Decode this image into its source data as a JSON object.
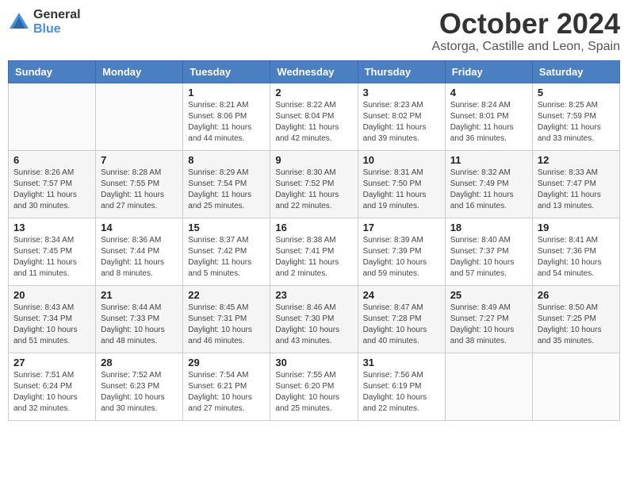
{
  "logo": {
    "general": "General",
    "blue": "Blue"
  },
  "title": "October 2024",
  "location": "Astorga, Castille and Leon, Spain",
  "days_of_week": [
    "Sunday",
    "Monday",
    "Tuesday",
    "Wednesday",
    "Thursday",
    "Friday",
    "Saturday"
  ],
  "weeks": [
    [
      {
        "day": "",
        "info": ""
      },
      {
        "day": "",
        "info": ""
      },
      {
        "day": "1",
        "info": "Sunrise: 8:21 AM\nSunset: 8:06 PM\nDaylight: 11 hours\nand 44 minutes."
      },
      {
        "day": "2",
        "info": "Sunrise: 8:22 AM\nSunset: 8:04 PM\nDaylight: 11 hours\nand 42 minutes."
      },
      {
        "day": "3",
        "info": "Sunrise: 8:23 AM\nSunset: 8:02 PM\nDaylight: 11 hours\nand 39 minutes."
      },
      {
        "day": "4",
        "info": "Sunrise: 8:24 AM\nSunset: 8:01 PM\nDaylight: 11 hours\nand 36 minutes."
      },
      {
        "day": "5",
        "info": "Sunrise: 8:25 AM\nSunset: 7:59 PM\nDaylight: 11 hours\nand 33 minutes."
      }
    ],
    [
      {
        "day": "6",
        "info": "Sunrise: 8:26 AM\nSunset: 7:57 PM\nDaylight: 11 hours\nand 30 minutes."
      },
      {
        "day": "7",
        "info": "Sunrise: 8:28 AM\nSunset: 7:55 PM\nDaylight: 11 hours\nand 27 minutes."
      },
      {
        "day": "8",
        "info": "Sunrise: 8:29 AM\nSunset: 7:54 PM\nDaylight: 11 hours\nand 25 minutes."
      },
      {
        "day": "9",
        "info": "Sunrise: 8:30 AM\nSunset: 7:52 PM\nDaylight: 11 hours\nand 22 minutes."
      },
      {
        "day": "10",
        "info": "Sunrise: 8:31 AM\nSunset: 7:50 PM\nDaylight: 11 hours\nand 19 minutes."
      },
      {
        "day": "11",
        "info": "Sunrise: 8:32 AM\nSunset: 7:49 PM\nDaylight: 11 hours\nand 16 minutes."
      },
      {
        "day": "12",
        "info": "Sunrise: 8:33 AM\nSunset: 7:47 PM\nDaylight: 11 hours\nand 13 minutes."
      }
    ],
    [
      {
        "day": "13",
        "info": "Sunrise: 8:34 AM\nSunset: 7:45 PM\nDaylight: 11 hours\nand 11 minutes."
      },
      {
        "day": "14",
        "info": "Sunrise: 8:36 AM\nSunset: 7:44 PM\nDaylight: 11 hours\nand 8 minutes."
      },
      {
        "day": "15",
        "info": "Sunrise: 8:37 AM\nSunset: 7:42 PM\nDaylight: 11 hours\nand 5 minutes."
      },
      {
        "day": "16",
        "info": "Sunrise: 8:38 AM\nSunset: 7:41 PM\nDaylight: 11 hours\nand 2 minutes."
      },
      {
        "day": "17",
        "info": "Sunrise: 8:39 AM\nSunset: 7:39 PM\nDaylight: 10 hours\nand 59 minutes."
      },
      {
        "day": "18",
        "info": "Sunrise: 8:40 AM\nSunset: 7:37 PM\nDaylight: 10 hours\nand 57 minutes."
      },
      {
        "day": "19",
        "info": "Sunrise: 8:41 AM\nSunset: 7:36 PM\nDaylight: 10 hours\nand 54 minutes."
      }
    ],
    [
      {
        "day": "20",
        "info": "Sunrise: 8:43 AM\nSunset: 7:34 PM\nDaylight: 10 hours\nand 51 minutes."
      },
      {
        "day": "21",
        "info": "Sunrise: 8:44 AM\nSunset: 7:33 PM\nDaylight: 10 hours\nand 48 minutes."
      },
      {
        "day": "22",
        "info": "Sunrise: 8:45 AM\nSunset: 7:31 PM\nDaylight: 10 hours\nand 46 minutes."
      },
      {
        "day": "23",
        "info": "Sunrise: 8:46 AM\nSunset: 7:30 PM\nDaylight: 10 hours\nand 43 minutes."
      },
      {
        "day": "24",
        "info": "Sunrise: 8:47 AM\nSunset: 7:28 PM\nDaylight: 10 hours\nand 40 minutes."
      },
      {
        "day": "25",
        "info": "Sunrise: 8:49 AM\nSunset: 7:27 PM\nDaylight: 10 hours\nand 38 minutes."
      },
      {
        "day": "26",
        "info": "Sunrise: 8:50 AM\nSunset: 7:25 PM\nDaylight: 10 hours\nand 35 minutes."
      }
    ],
    [
      {
        "day": "27",
        "info": "Sunrise: 7:51 AM\nSunset: 6:24 PM\nDaylight: 10 hours\nand 32 minutes."
      },
      {
        "day": "28",
        "info": "Sunrise: 7:52 AM\nSunset: 6:23 PM\nDaylight: 10 hours\nand 30 minutes."
      },
      {
        "day": "29",
        "info": "Sunrise: 7:54 AM\nSunset: 6:21 PM\nDaylight: 10 hours\nand 27 minutes."
      },
      {
        "day": "30",
        "info": "Sunrise: 7:55 AM\nSunset: 6:20 PM\nDaylight: 10 hours\nand 25 minutes."
      },
      {
        "day": "31",
        "info": "Sunrise: 7:56 AM\nSunset: 6:19 PM\nDaylight: 10 hours\nand 22 minutes."
      },
      {
        "day": "",
        "info": ""
      },
      {
        "day": "",
        "info": ""
      }
    ]
  ]
}
